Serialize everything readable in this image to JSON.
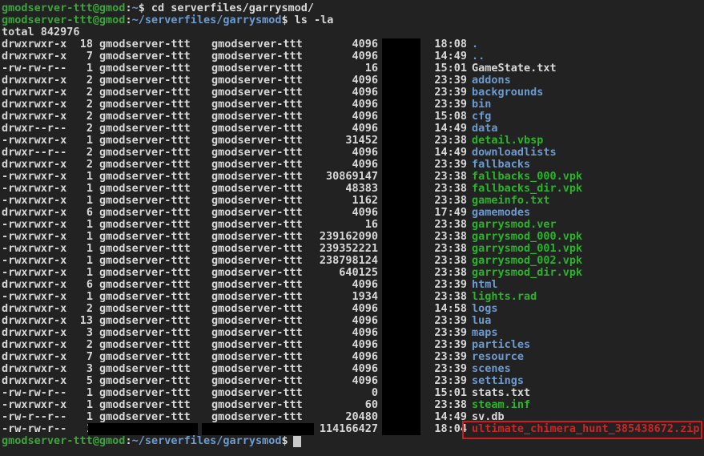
{
  "terminal": {
    "colors": {
      "background": "#222222",
      "default_text": "#d8d8d8",
      "prompt_green": "#3da33d",
      "path_blue": "#6d9bcf",
      "directory_blue": "#6d9bcf",
      "executable_green": "#2bb42b",
      "highlight_red": "#cc2626",
      "annotation_border_red": "#d21c1c",
      "redaction_black": "#000000",
      "cursor_gray": "#c9c9c9"
    },
    "prompt": {
      "user_host": "gmodserver-ttt@gmod",
      "colon": ":",
      "home": "~",
      "cwd": "~/serverfiles/garrysmod",
      "dollar": "$"
    },
    "commands": {
      "cd": "cd serverfiles/garrysmod/",
      "ls": "ls -la"
    },
    "total_line": "total 842976",
    "listing": [
      {
        "perms": "drwxrwxr-x",
        "links": "18",
        "owner": "gmodserver-ttt",
        "group": "gmodserver-ttt",
        "size": "4096",
        "time": "18:08",
        "name": ".",
        "type": "dir",
        "redacted": false
      },
      {
        "perms": "drwxrwxr-x",
        "links": "7",
        "owner": "gmodserver-ttt",
        "group": "gmodserver-ttt",
        "size": "4096",
        "time": "14:49",
        "name": "..",
        "type": "dir",
        "redacted": false
      },
      {
        "perms": "-rw-rw-r--",
        "links": "1",
        "owner": "gmodserver-ttt",
        "group": "gmodserver-ttt",
        "size": "16",
        "time": "15:01",
        "name": "GameState.txt",
        "type": "file",
        "redacted": false
      },
      {
        "perms": "drwxrwxr-x",
        "links": "2",
        "owner": "gmodserver-ttt",
        "group": "gmodserver-ttt",
        "size": "4096",
        "time": "23:39",
        "name": "addons",
        "type": "dir",
        "redacted": false
      },
      {
        "perms": "drwxrwxr-x",
        "links": "2",
        "owner": "gmodserver-ttt",
        "group": "gmodserver-ttt",
        "size": "4096",
        "time": "23:39",
        "name": "backgrounds",
        "type": "dir",
        "redacted": false
      },
      {
        "perms": "drwxrwxr-x",
        "links": "2",
        "owner": "gmodserver-ttt",
        "group": "gmodserver-ttt",
        "size": "4096",
        "time": "23:39",
        "name": "bin",
        "type": "dir",
        "redacted": false
      },
      {
        "perms": "drwxrwxr-x",
        "links": "2",
        "owner": "gmodserver-ttt",
        "group": "gmodserver-ttt",
        "size": "4096",
        "time": "15:08",
        "name": "cfg",
        "type": "dir",
        "redacted": false
      },
      {
        "perms": "drwxr--r--",
        "links": "2",
        "owner": "gmodserver-ttt",
        "group": "gmodserver-ttt",
        "size": "4096",
        "time": "14:49",
        "name": "data",
        "type": "dir",
        "redacted": false
      },
      {
        "perms": "-rwxrwxr-x",
        "links": "1",
        "owner": "gmodserver-ttt",
        "group": "gmodserver-ttt",
        "size": "31452",
        "time": "23:38",
        "name": "detail.vbsp",
        "type": "exec",
        "redacted": false
      },
      {
        "perms": "drwxr--r--",
        "links": "2",
        "owner": "gmodserver-ttt",
        "group": "gmodserver-ttt",
        "size": "4096",
        "time": "14:49",
        "name": "downloadlists",
        "type": "dir",
        "redacted": false
      },
      {
        "perms": "drwxrwxr-x",
        "links": "2",
        "owner": "gmodserver-ttt",
        "group": "gmodserver-ttt",
        "size": "4096",
        "time": "23:39",
        "name": "fallbacks",
        "type": "dir",
        "redacted": false
      },
      {
        "perms": "-rwxrwxr-x",
        "links": "1",
        "owner": "gmodserver-ttt",
        "group": "gmodserver-ttt",
        "size": "30869147",
        "time": "23:38",
        "name": "fallbacks_000.vpk",
        "type": "exec",
        "redacted": false
      },
      {
        "perms": "-rwxrwxr-x",
        "links": "1",
        "owner": "gmodserver-ttt",
        "group": "gmodserver-ttt",
        "size": "48383",
        "time": "23:38",
        "name": "fallbacks_dir.vpk",
        "type": "exec",
        "redacted": false
      },
      {
        "perms": "-rwxrwxr-x",
        "links": "1",
        "owner": "gmodserver-ttt",
        "group": "gmodserver-ttt",
        "size": "1162",
        "time": "23:38",
        "name": "gameinfo.txt",
        "type": "exec",
        "redacted": false
      },
      {
        "perms": "drwxrwxr-x",
        "links": "6",
        "owner": "gmodserver-ttt",
        "group": "gmodserver-ttt",
        "size": "4096",
        "time": "17:49",
        "name": "gamemodes",
        "type": "dir",
        "redacted": false
      },
      {
        "perms": "-rwxrwxr-x",
        "links": "1",
        "owner": "gmodserver-ttt",
        "group": "gmodserver-ttt",
        "size": "16",
        "time": "23:38",
        "name": "garrysmod.ver",
        "type": "exec",
        "redacted": false
      },
      {
        "perms": "-rwxrwxr-x",
        "links": "1",
        "owner": "gmodserver-ttt",
        "group": "gmodserver-ttt",
        "size": "239162090",
        "time": "23:38",
        "name": "garrysmod_000.vpk",
        "type": "exec",
        "redacted": false
      },
      {
        "perms": "-rwxrwxr-x",
        "links": "1",
        "owner": "gmodserver-ttt",
        "group": "gmodserver-ttt",
        "size": "239352221",
        "time": "23:38",
        "name": "garrysmod_001.vpk",
        "type": "exec",
        "redacted": false
      },
      {
        "perms": "-rwxrwxr-x",
        "links": "1",
        "owner": "gmodserver-ttt",
        "group": "gmodserver-ttt",
        "size": "238798124",
        "time": "23:38",
        "name": "garrysmod_002.vpk",
        "type": "exec",
        "redacted": false
      },
      {
        "perms": "-rwxrwxr-x",
        "links": "1",
        "owner": "gmodserver-ttt",
        "group": "gmodserver-ttt",
        "size": "640125",
        "time": "23:38",
        "name": "garrysmod_dir.vpk",
        "type": "exec",
        "redacted": false
      },
      {
        "perms": "drwxrwxr-x",
        "links": "6",
        "owner": "gmodserver-ttt",
        "group": "gmodserver-ttt",
        "size": "4096",
        "time": "23:39",
        "name": "html",
        "type": "dir",
        "redacted": false
      },
      {
        "perms": "-rwxrwxr-x",
        "links": "1",
        "owner": "gmodserver-ttt",
        "group": "gmodserver-ttt",
        "size": "1934",
        "time": "23:38",
        "name": "lights.rad",
        "type": "exec",
        "redacted": false
      },
      {
        "perms": "drwxrwxr-x",
        "links": "2",
        "owner": "gmodserver-ttt",
        "group": "gmodserver-ttt",
        "size": "4096",
        "time": "14:58",
        "name": "logs",
        "type": "dir",
        "redacted": false
      },
      {
        "perms": "drwxrwxr-x",
        "links": "13",
        "owner": "gmodserver-ttt",
        "group": "gmodserver-ttt",
        "size": "4096",
        "time": "23:39",
        "name": "lua",
        "type": "dir",
        "redacted": false
      },
      {
        "perms": "drwxrwxr-x",
        "links": "3",
        "owner": "gmodserver-ttt",
        "group": "gmodserver-ttt",
        "size": "4096",
        "time": "23:39",
        "name": "maps",
        "type": "dir",
        "redacted": false
      },
      {
        "perms": "drwxrwxr-x",
        "links": "2",
        "owner": "gmodserver-ttt",
        "group": "gmodserver-ttt",
        "size": "4096",
        "time": "23:39",
        "name": "particles",
        "type": "dir",
        "redacted": false
      },
      {
        "perms": "drwxrwxr-x",
        "links": "7",
        "owner": "gmodserver-ttt",
        "group": "gmodserver-ttt",
        "size": "4096",
        "time": "23:39",
        "name": "resource",
        "type": "dir",
        "redacted": false
      },
      {
        "perms": "drwxrwxr-x",
        "links": "3",
        "owner": "gmodserver-ttt",
        "group": "gmodserver-ttt",
        "size": "4096",
        "time": "23:39",
        "name": "scenes",
        "type": "dir",
        "redacted": false
      },
      {
        "perms": "drwxrwxr-x",
        "links": "5",
        "owner": "gmodserver-ttt",
        "group": "gmodserver-ttt",
        "size": "4096",
        "time": "23:39",
        "name": "settings",
        "type": "dir",
        "redacted": false
      },
      {
        "perms": "-rw-rw-r--",
        "links": "1",
        "owner": "gmodserver-ttt",
        "group": "gmodserver-ttt",
        "size": "0",
        "time": "15:01",
        "name": "stats.txt",
        "type": "file",
        "redacted": false
      },
      {
        "perms": "-rwxrwxr-x",
        "links": "1",
        "owner": "gmodserver-ttt",
        "group": "gmodserver-ttt",
        "size": "60",
        "time": "23:38",
        "name": "steam.inf",
        "type": "exec",
        "redacted": false
      },
      {
        "perms": "-rw-r--r--",
        "links": "1",
        "owner": "gmodserver-ttt",
        "group": "gmodserver-ttt",
        "size": "20480",
        "time": "14:49",
        "name": "sv.db",
        "type": "file",
        "redacted": false
      },
      {
        "perms": "-rw-rw-r--",
        "links": "1",
        "owner": "",
        "group": "",
        "size": "114166427",
        "time": "18:04",
        "name": "ultimate_chimera_hunt_385438672.zip",
        "type": "highlight",
        "redacted": true
      }
    ],
    "annotation": {
      "highlighted_file": "ultimate_chimera_hunt_385438672.zip"
    }
  }
}
